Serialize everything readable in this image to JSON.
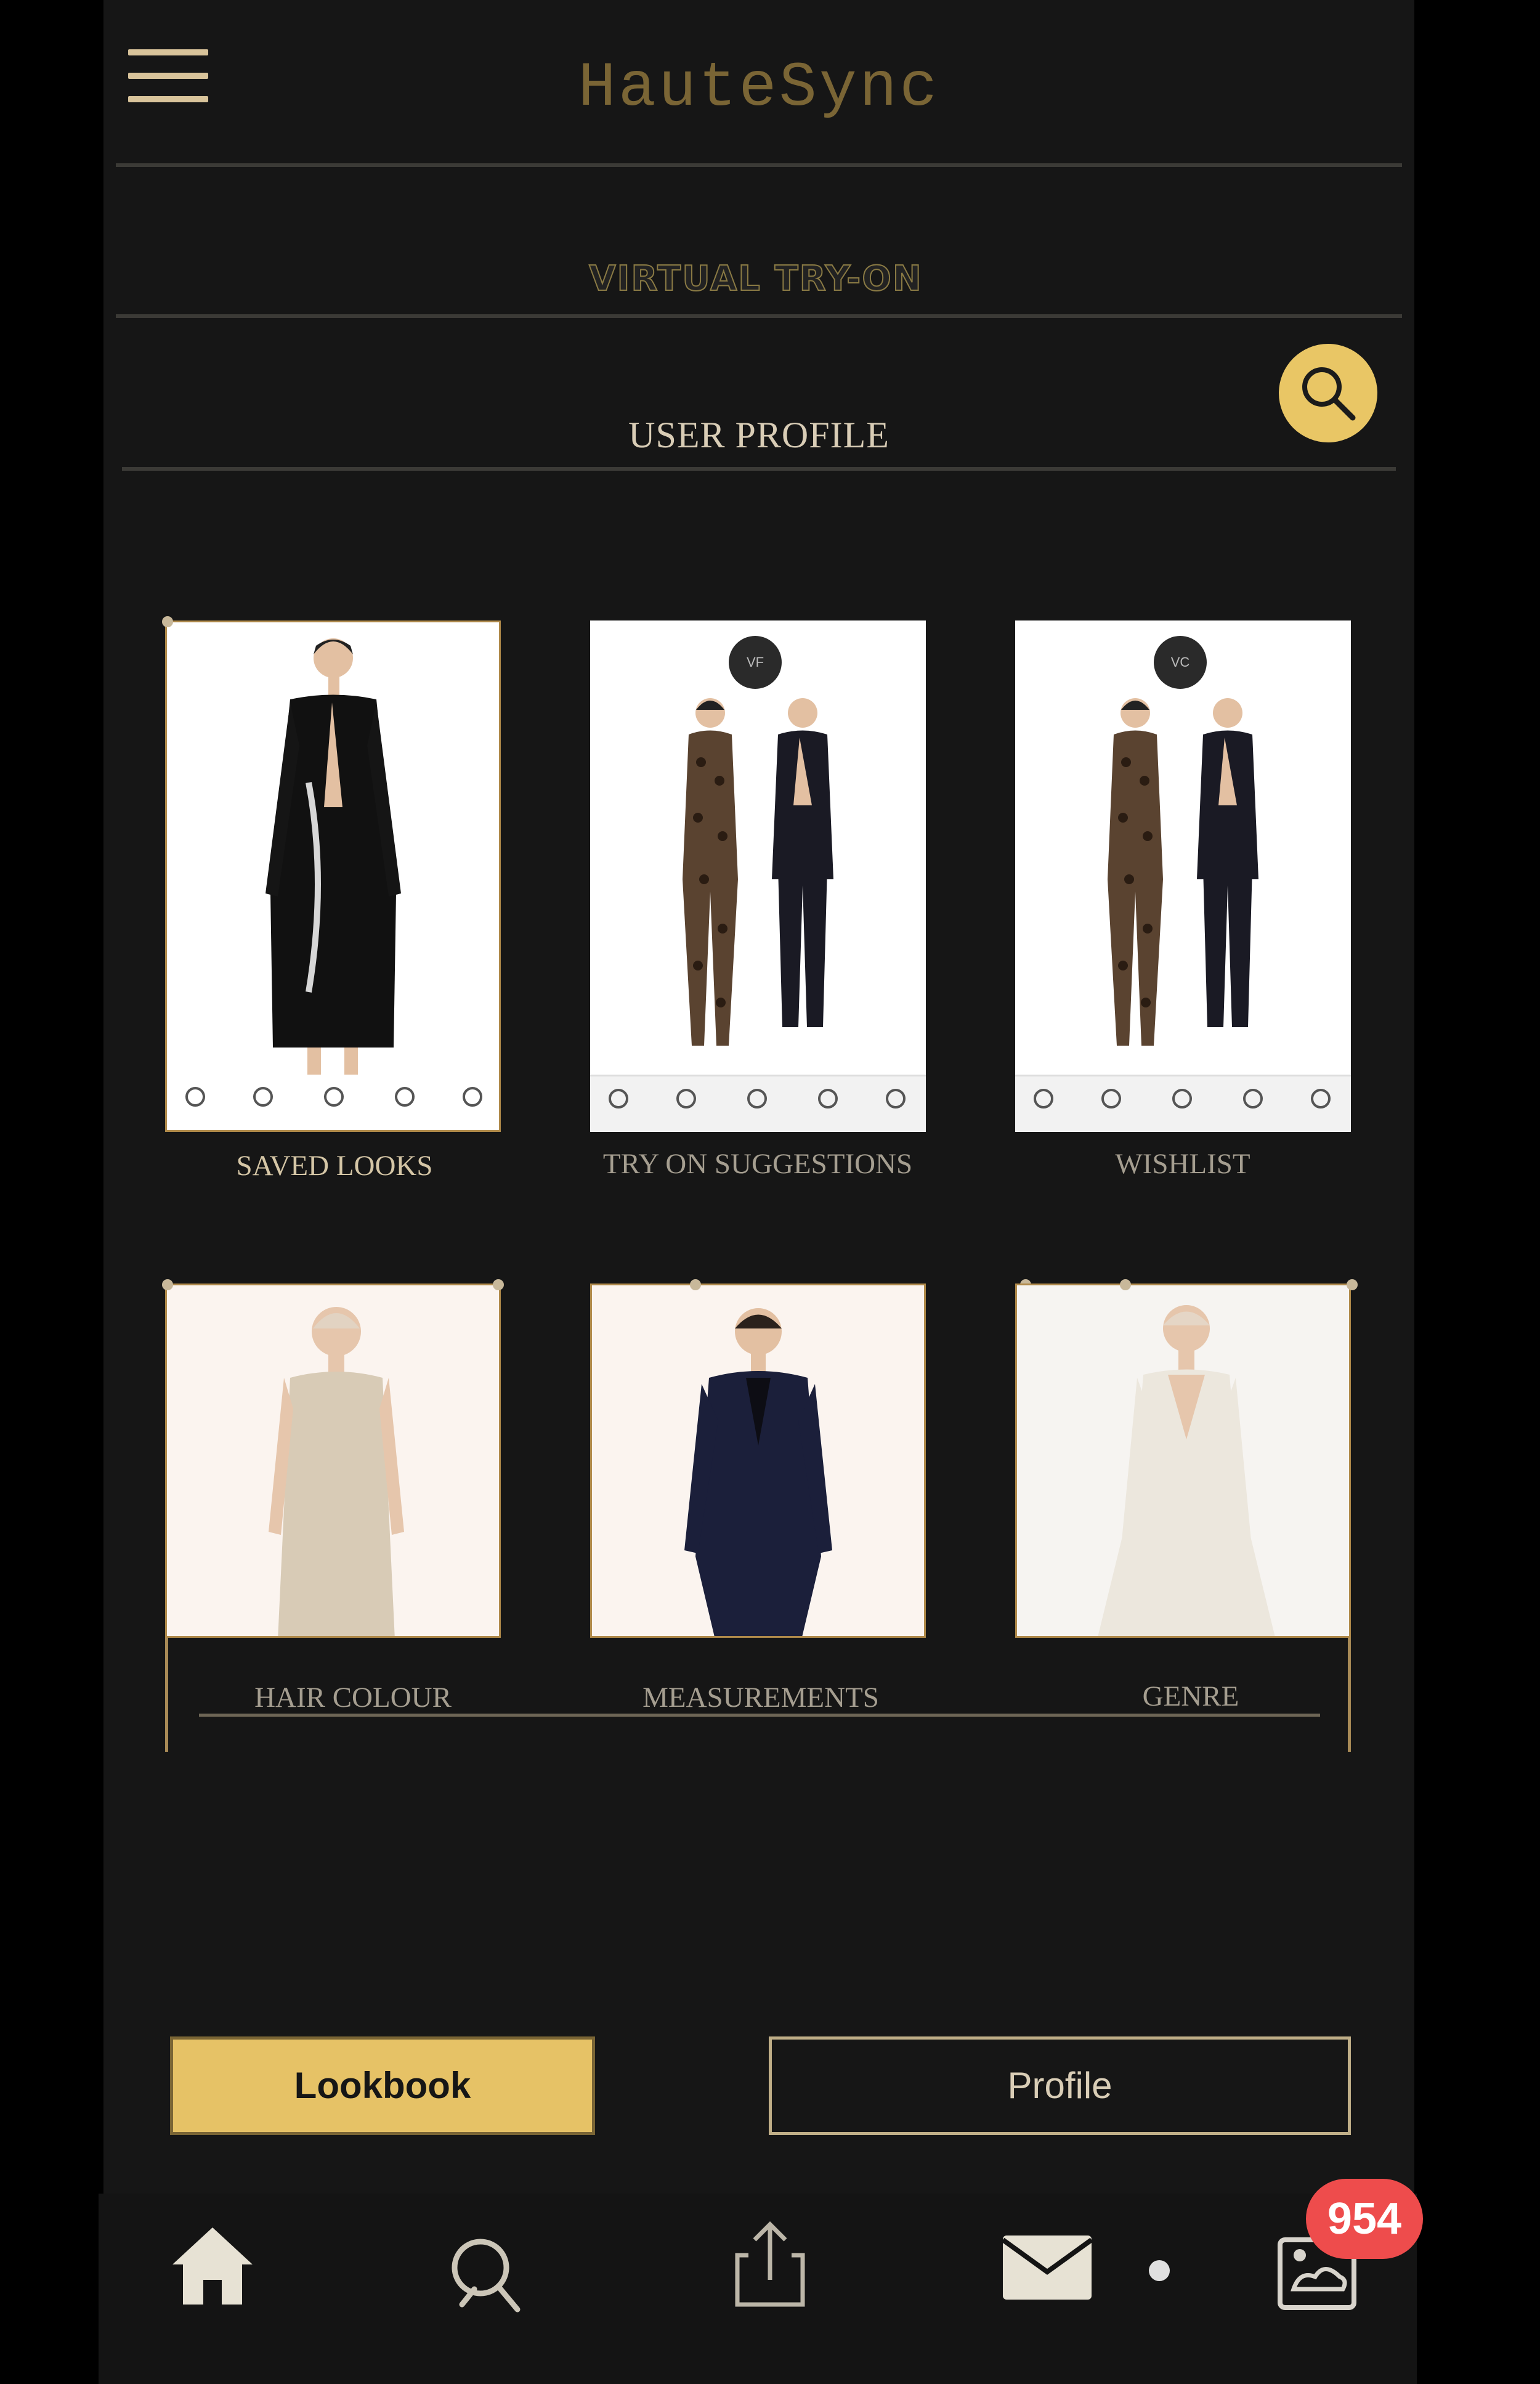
{
  "header": {
    "app_title": "HauteSync",
    "menu_icon": "hamburger-icon"
  },
  "sections": {
    "virtual_try_on": "VIRTUAL TRY-ON",
    "user_profile": "USER PROFILE",
    "search_icon": "search-icon"
  },
  "cards": [
    {
      "label": "SAVED LOOKS",
      "image": "woman-black-leather-coat"
    },
    {
      "label": "TRY ON SUGGESTIONS",
      "image": "two-models-leopard-catsuit-and-suit",
      "badge": "VF"
    },
    {
      "label": "WISHLIST",
      "image": "two-models-leopard-catsuit-and-suit",
      "badge": "VC"
    },
    {
      "label": "HAIR COLOUR",
      "image": "woman-beige-sleeveless-dress"
    },
    {
      "label": "MEASUREMENTS",
      "image": "woman-navy-pantsuit"
    },
    {
      "label": "GENRE",
      "image": "woman-white-v-neck-gown"
    }
  ],
  "buttons": {
    "lookbook": "Lookbook",
    "profile": "Profile"
  },
  "tabbar": {
    "home_icon": "home-icon",
    "search_icon": "search-icon",
    "share_icon": "share-icon",
    "mail_icon": "mail-icon",
    "gallery_icon": "gallery-icon",
    "badge_count": "954"
  },
  "colors": {
    "background": "#161616",
    "accent_gold": "#e6c266",
    "title_gold": "#7a6535",
    "badge_red": "#ee4c4c"
  }
}
